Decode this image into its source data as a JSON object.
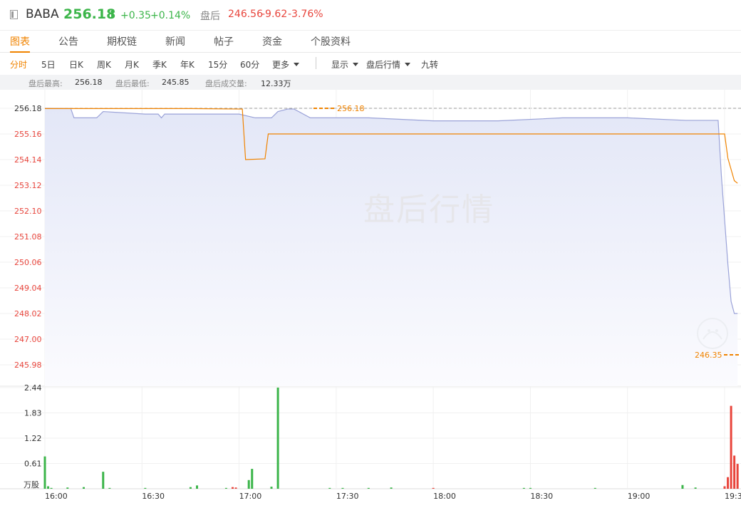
{
  "header": {
    "symbol": "BABA",
    "price": "256.18",
    "arrow": "⬆",
    "change": "+0.35",
    "change_pct": "+0.14%",
    "after_hours_label": "盘后",
    "after_hours_price": "246.56",
    "after_hours_change": "-9.62",
    "after_hours_change_pct": "-3.76%"
  },
  "tabs": [
    {
      "label": "图表",
      "active": true
    },
    {
      "label": "公告"
    },
    {
      "label": "期权链"
    },
    {
      "label": "新闻"
    },
    {
      "label": "帖子"
    },
    {
      "label": "资金"
    },
    {
      "label": "个股资料"
    }
  ],
  "periods": [
    "分时",
    "5日",
    "日K",
    "周K",
    "月K",
    "季K",
    "年K",
    "15分",
    "60分",
    "更多"
  ],
  "options": [
    "显示",
    "盘后行情",
    "九转"
  ],
  "stats": {
    "high_label": "盘后最高:",
    "high": "256.18",
    "low_label": "盘后最低:",
    "low": "245.85",
    "vol_label": "盘后成交量:",
    "vol": "12.33万"
  },
  "watermark": "盘后行情",
  "colors": {
    "up": "#e8453c",
    "down": "#3cb54a",
    "accent": "#f08300",
    "price_line": "#9aa2d8"
  },
  "chart_data": {
    "type": "line",
    "x_tick_labels": [
      "16:00",
      "16:30",
      "17:00",
      "17:30",
      "18:00",
      "18:30",
      "19:00",
      "19:30"
    ],
    "price_axis_ticks": [
      "256.18",
      "255.16",
      "254.14",
      "253.12",
      "252.10",
      "251.08",
      "250.06",
      "249.04",
      "248.02",
      "247.00",
      "245.98"
    ],
    "volume_axis_ticks": [
      "2.44",
      "1.83",
      "1.22",
      "0.61"
    ],
    "volume_unit": "万股",
    "markers": [
      {
        "label": "256.18"
      },
      {
        "label": "246.35"
      }
    ],
    "ylim": [
      245.98,
      256.18
    ],
    "volume_ylim": [
      0,
      2.44
    ],
    "price": {
      "x": [
        "16:00",
        "16:08",
        "16:09",
        "16:16",
        "16:18",
        "16:31",
        "16:35",
        "16:36",
        "16:37",
        "16:48",
        "16:50",
        "17:00",
        "17:05",
        "17:10",
        "17:12",
        "17:15",
        "17:17",
        "17:22",
        "17:35",
        "17:40",
        "18:00",
        "18:01",
        "18:20",
        "18:40",
        "19:00",
        "19:18",
        "19:20",
        "19:28",
        "19:29",
        "19:31",
        "19:32",
        "19:33",
        "19:34"
      ],
      "values": [
        256.18,
        256.17,
        255.8,
        255.8,
        256.05,
        255.95,
        255.95,
        255.8,
        255.95,
        255.95,
        255.95,
        255.95,
        255.8,
        255.8,
        256.05,
        256.15,
        256.15,
        255.8,
        255.8,
        255.8,
        255.68,
        255.68,
        255.68,
        255.8,
        255.8,
        255.7,
        255.7,
        255.7,
        253.5,
        250.0,
        248.5,
        248.02,
        248.02
      ]
    },
    "avg_price": {
      "x": [
        "16:00",
        "16:30",
        "16:45",
        "17:01",
        "17:02",
        "17:08",
        "17:09",
        "17:30",
        "18:00",
        "18:30",
        "19:00",
        "19:29",
        "19:30",
        "19:31",
        "19:33",
        "19:34"
      ],
      "values": [
        256.17,
        256.17,
        256.17,
        256.15,
        254.14,
        254.17,
        255.16,
        255.16,
        255.16,
        255.16,
        255.16,
        255.16,
        255.16,
        254.2,
        253.3,
        253.2
      ]
    },
    "volume": {
      "x": [
        "16:00",
        "16:01",
        "16:02",
        "16:07",
        "16:12",
        "16:18",
        "16:20",
        "16:31",
        "16:45",
        "16:47",
        "16:56",
        "16:58",
        "16:59",
        "17:03",
        "17:04",
        "17:10",
        "17:12",
        "17:28",
        "17:32",
        "17:40",
        "17:47",
        "18:00",
        "18:28",
        "18:30",
        "18:50",
        "19:17",
        "19:21",
        "19:30",
        "19:31",
        "19:32",
        "19:33",
        "19:34"
      ],
      "values": [
        0.78,
        0.06,
        0.02,
        0.03,
        0.04,
        0.41,
        0.02,
        0.02,
        0.04,
        0.08,
        0.02,
        0.04,
        0.03,
        0.21,
        0.48,
        0.05,
        2.44,
        0.02,
        0.02,
        0.02,
        0.03,
        0.02,
        0.02,
        0.02,
        0.02,
        0.09,
        0.03,
        0.06,
        0.28,
        2.0,
        0.8,
        0.6
      ],
      "color": [
        "down",
        "down",
        "down",
        "down",
        "down",
        "down",
        "down",
        "down",
        "down",
        "down",
        "down",
        "up",
        "up",
        "down",
        "down",
        "down",
        "down",
        "down",
        "down",
        "down",
        "down",
        "up",
        "down",
        "down",
        "down",
        "down",
        "down",
        "up",
        "up",
        "up",
        "up",
        "up"
      ]
    }
  }
}
